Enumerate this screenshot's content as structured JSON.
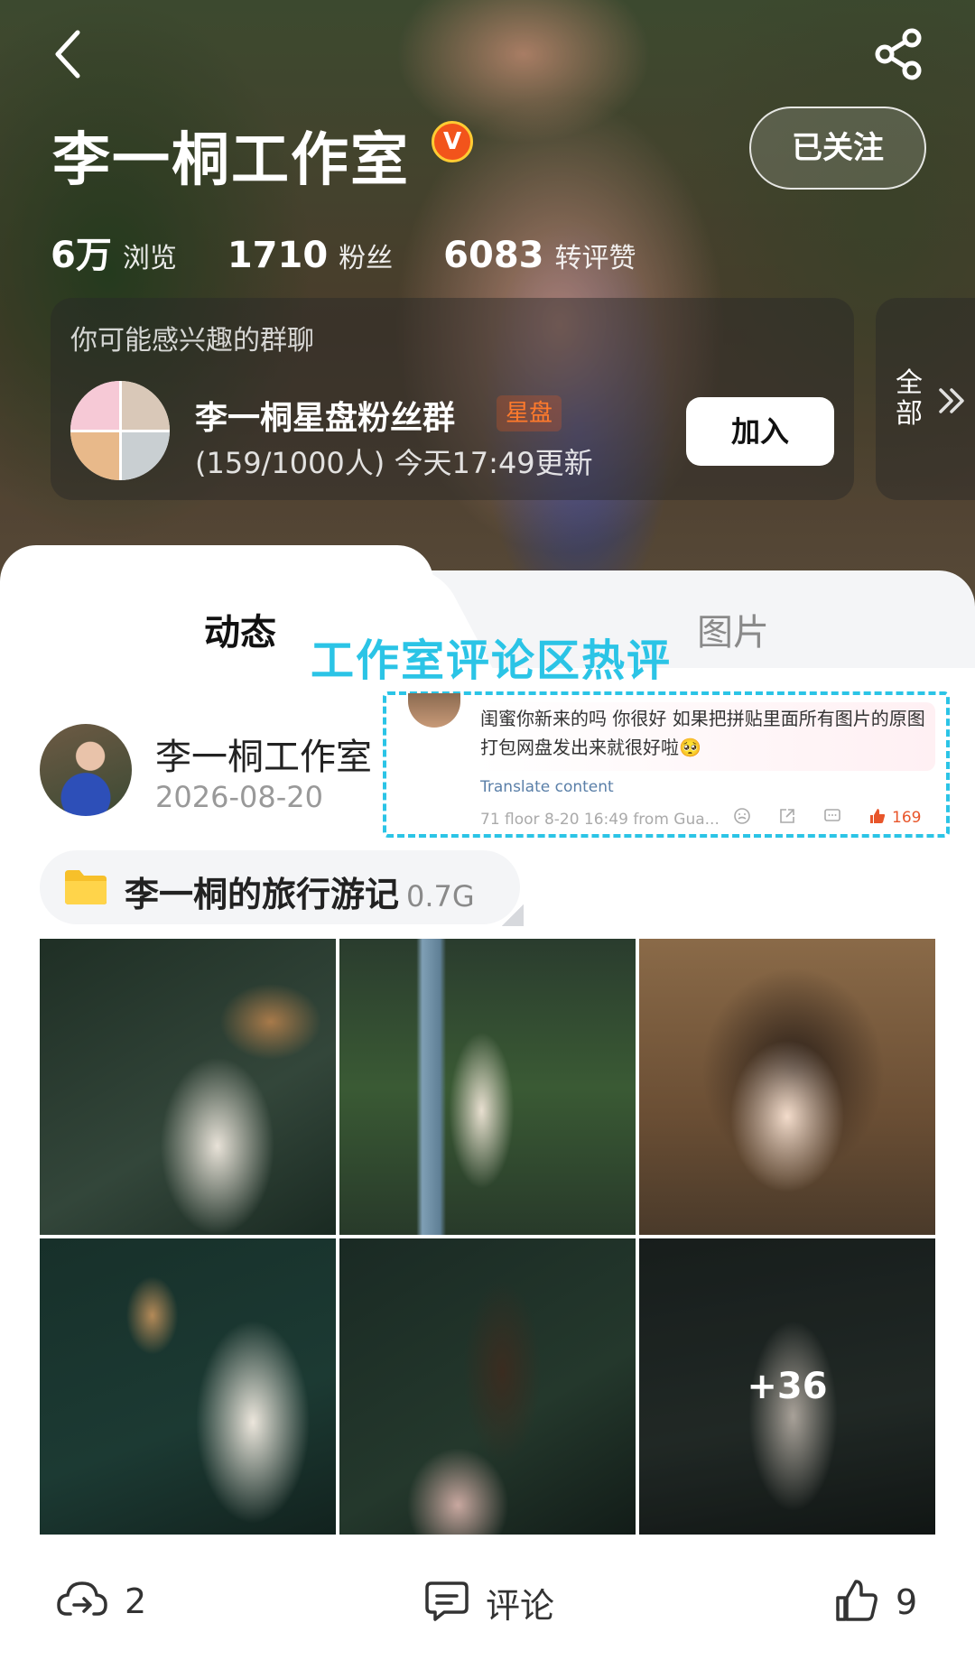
{
  "header": {
    "name": "李一桐工作室",
    "verified_badge": "V",
    "follow_label": "已关注",
    "stats": [
      {
        "value": "6万",
        "label": "浏览"
      },
      {
        "value": "1710",
        "label": "粉丝"
      },
      {
        "value": "6083",
        "label": "转评赞"
      }
    ]
  },
  "group_card": {
    "title": "你可能感兴趣的群聊",
    "group_name": "李一桐星盘粉丝群",
    "tag": "星盘",
    "subtitle": "(159/1000人) 今天17:49更新",
    "join_label": "加入",
    "all_label": "全部"
  },
  "tabs": [
    {
      "label": "动态",
      "active": true
    },
    {
      "label": "图片",
      "active": false
    }
  ],
  "annotation": "工作室评论区热评",
  "post": {
    "author": "李一桐工作室",
    "date": "2026-08-20",
    "file": {
      "name": "李一桐的旅行游记",
      "size": "0.7G"
    },
    "more_count": "+36",
    "actions": {
      "repost": "2",
      "comment": "评论",
      "like": "9"
    }
  },
  "comment": {
    "text": "闺蜜你新来的吗 你很好 如果把拼贴里面所有图片的原图打包网盘发出来就很好啦🥺",
    "translate": "Translate content",
    "meta": "71 floor 8-20 16:49 from Gua...",
    "likes": "169"
  },
  "colors": {
    "accent": "#2bc4e6",
    "verified": "#f2541b",
    "tag": "#ff7a2c",
    "like": "#e8552a"
  }
}
